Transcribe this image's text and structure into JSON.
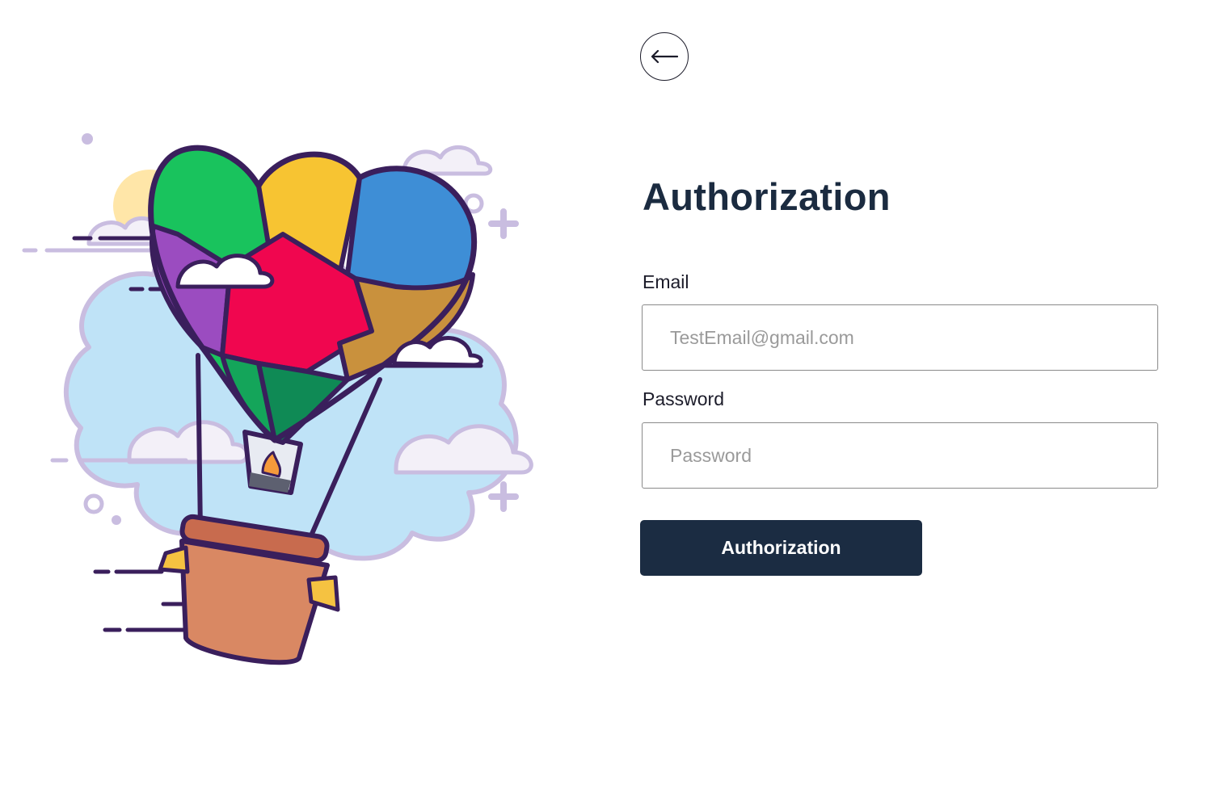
{
  "header": {
    "back_icon": "arrow-left-icon"
  },
  "form": {
    "title": "Authorization",
    "email_label": "Email",
    "email_placeholder": "TestEmail@gmail.com",
    "email_value": "",
    "password_label": "Password",
    "password_placeholder": "Password",
    "password_value": "",
    "submit_label": "Authorization"
  },
  "illustration": {
    "subject": "heart-puzzle-hot-air-balloon-illustration"
  },
  "colors": {
    "primary": "#1b2c42",
    "title": "#1b2b40",
    "input_border": "#8a8a8a",
    "placeholder": "#9a9a9a"
  }
}
